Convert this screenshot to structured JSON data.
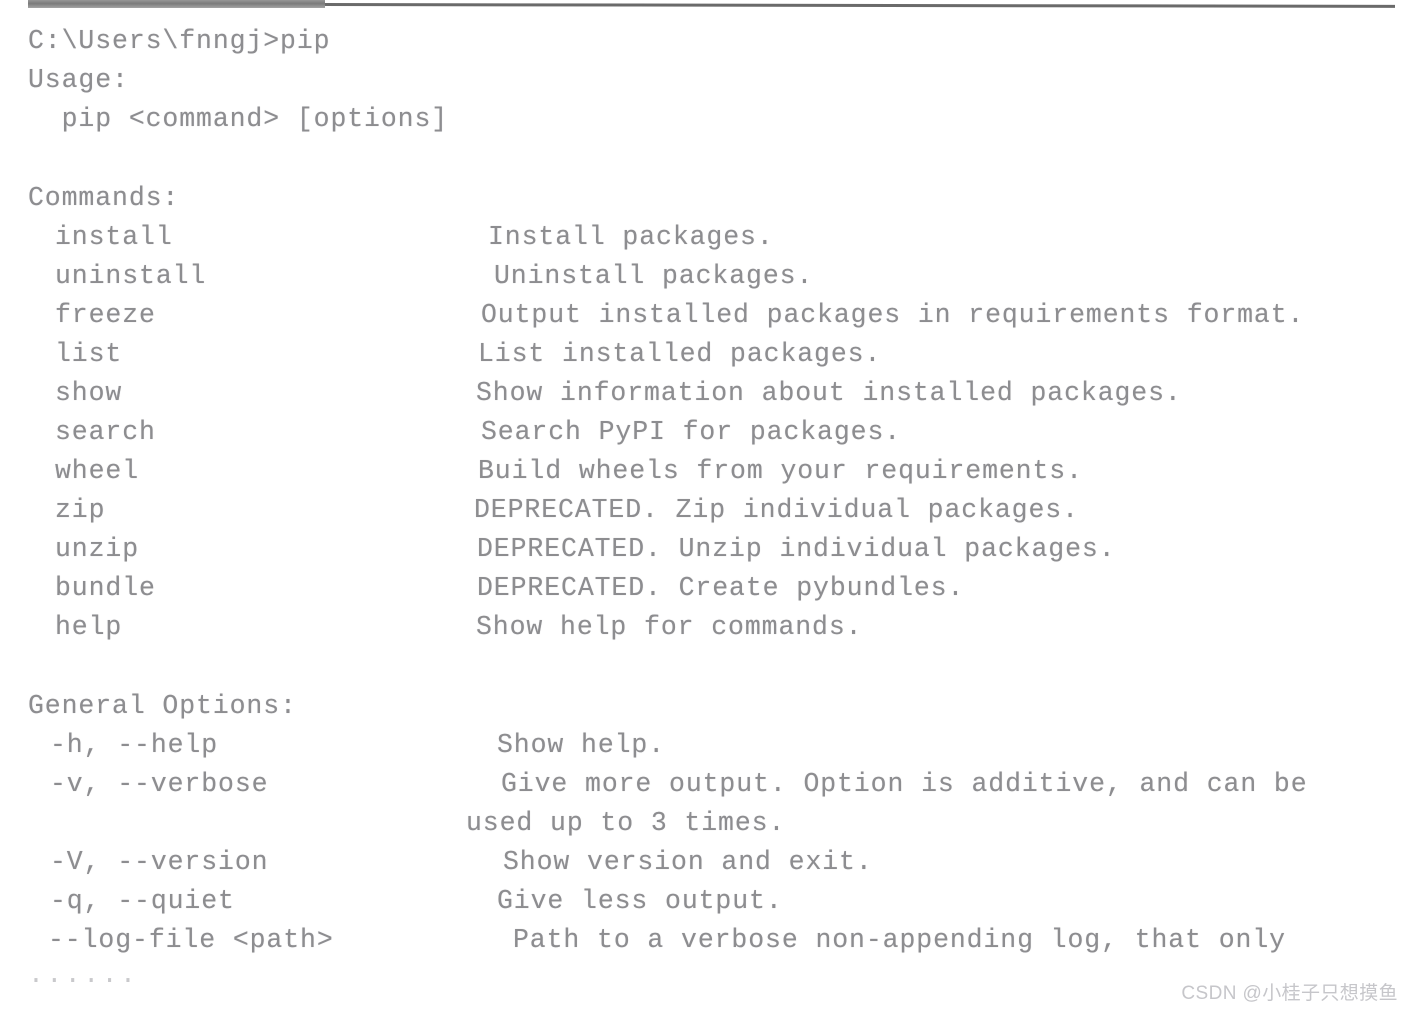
{
  "document": {
    "kind": "scanned-terminal-output",
    "text_color": "#8d8d90",
    "background_color": "#ffffff",
    "rule_color": "#6f6f6f"
  },
  "prompt": {
    "line": "C:\\Users\\fnngj>pip"
  },
  "usage": {
    "heading": "Usage:",
    "line": "  pip <command> [options]"
  },
  "commands": {
    "heading": "Commands:",
    "items": [
      {
        "name": "install",
        "description": "Install packages."
      },
      {
        "name": "uninstall",
        "description": "Uninstall packages."
      },
      {
        "name": "freeze",
        "description": "Output installed packages in requirements format."
      },
      {
        "name": "list",
        "description": "List installed packages."
      },
      {
        "name": "show",
        "description": "Show information about installed packages."
      },
      {
        "name": "search",
        "description": "Search PyPI for packages."
      },
      {
        "name": "wheel",
        "description": "Build wheels from your requirements."
      },
      {
        "name": "zip",
        "description": "DEPRECATED. Zip individual packages."
      },
      {
        "name": "unzip",
        "description": "DEPRECATED. Unzip individual packages."
      },
      {
        "name": "bundle",
        "description": "DEPRECATED. Create pybundles."
      },
      {
        "name": "help",
        "description": "Show help for commands."
      }
    ]
  },
  "general_options": {
    "heading": "General Options:",
    "items": [
      {
        "flags": "-h, --help",
        "description": "Show help."
      },
      {
        "flags": "-v, --verbose",
        "description": "Give more output. Option is additive, and can be"
      },
      {
        "flags": "",
        "description": "used up to 3 times."
      },
      {
        "flags": "-V, --version",
        "description": "Show version and exit."
      },
      {
        "flags": "-q, --quiet",
        "description": "Give less output."
      },
      {
        "flags": "--log-file <path>",
        "description": "Path to a verbose non-appending log, that only"
      }
    ]
  },
  "truncation": {
    "ellipsis": "......"
  },
  "watermark": {
    "text": "CSDN @小桂子只想摸鱼"
  }
}
